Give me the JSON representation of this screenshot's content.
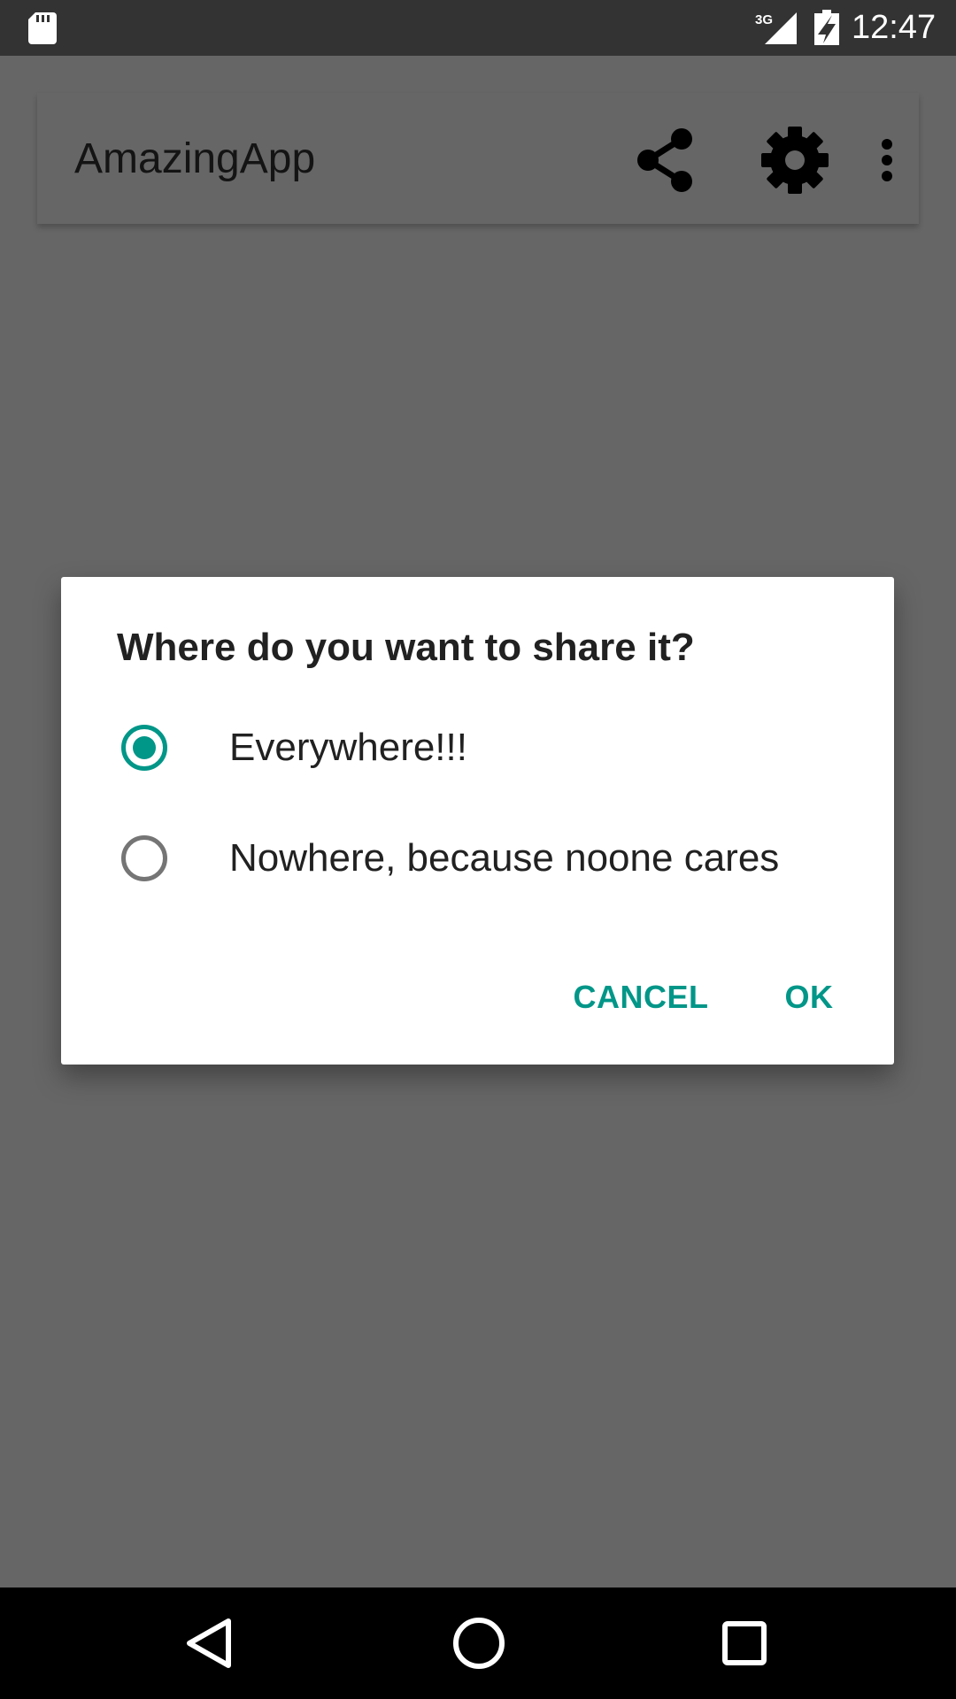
{
  "status_bar": {
    "time": "12:47",
    "network_label": "3G",
    "icons": [
      "sd-card-icon",
      "signal-3g-icon",
      "battery-charging-icon"
    ]
  },
  "toolbar": {
    "title": "AmazingApp",
    "actions": [
      "share-icon",
      "settings-gear-icon",
      "more-vert-icon"
    ]
  },
  "dialog": {
    "title": "Where do you want to share it?",
    "options": [
      {
        "label": "Everywhere!!!",
        "selected": true
      },
      {
        "label": "Nowhere, because noone cares",
        "selected": false
      }
    ],
    "cancel_label": "CANCEL",
    "ok_label": "OK"
  },
  "colors": {
    "accent": "#009688",
    "scrim_background": "#666666",
    "status_bar": "#333333",
    "nav_bar": "#000000",
    "dialog_background": "#ffffff",
    "radio_unselected": "#757575"
  },
  "nav_bar": {
    "icons": [
      "back-icon",
      "home-icon",
      "recents-icon"
    ]
  }
}
